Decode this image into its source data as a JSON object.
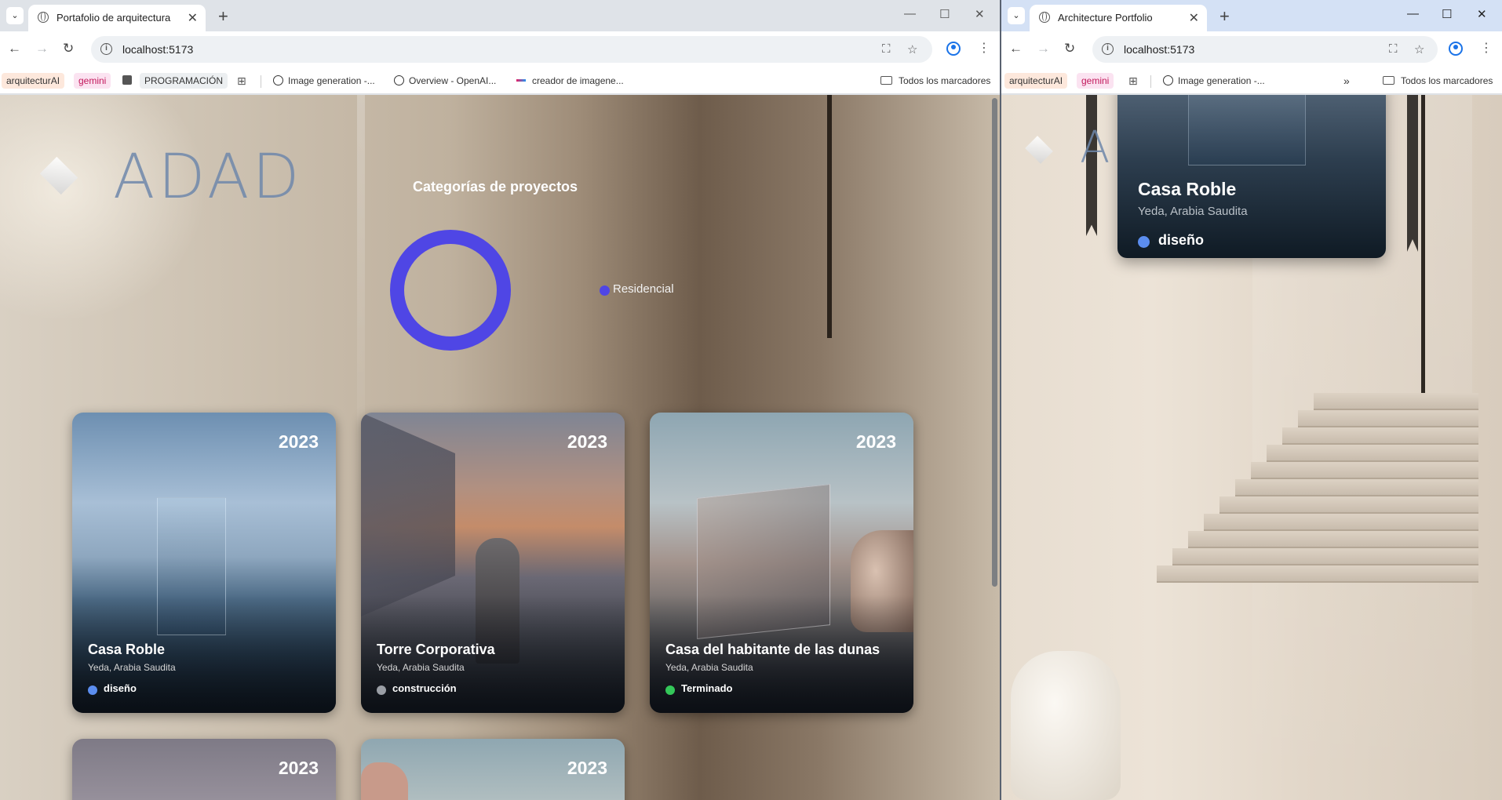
{
  "left_window": {
    "tab_title": "Portafolio de arquitectura",
    "url": "localhost:5173",
    "bookmarks": [
      {
        "label": "arquitecturAI",
        "bg": "#fde8dc"
      },
      {
        "label": "gemini",
        "bg": "#fbe3f1",
        "color": "#c2185b"
      },
      {
        "label": "PROGRAMACIÓN",
        "bg": "#eceff1"
      },
      {
        "label": "Image generation -..."
      },
      {
        "label": "Overview - OpenAI..."
      },
      {
        "label": "creador de imagene..."
      }
    ],
    "all_bookmarks": "Todos los marcadores",
    "page": {
      "logo": "ADAD",
      "chart_title": "Categorías de proyectos",
      "chart_data": {
        "type": "pie",
        "style": "donut",
        "categories": [
          "Residencial"
        ],
        "values": [
          1
        ],
        "colors": [
          "#4f46e5"
        ],
        "legend": "right"
      },
      "cards": [
        {
          "year": "2023",
          "name": "Casa Roble",
          "location": "Yeda, Arabia Saudita",
          "status": "diseño",
          "status_color": "#5b8def"
        },
        {
          "year": "2023",
          "name": "Torre Corporativa",
          "location": "Yeda, Arabia Saudita",
          "status": "construcción",
          "status_color": "#9a9ea5"
        },
        {
          "year": "2023",
          "name": "Casa del habitante de las dunas",
          "location": "Yeda, Arabia Saudita",
          "status": "Terminado",
          "status_color": "#34c759"
        },
        {
          "year": "2023"
        },
        {
          "year": "2023"
        }
      ]
    }
  },
  "right_window": {
    "tab_title": "Architecture Portfolio",
    "url": "localhost:5173",
    "bookmarks": [
      {
        "label": "arquitecturAI",
        "bg": "#fde8dc"
      },
      {
        "label": "gemini",
        "bg": "#fbe3f1",
        "color": "#c2185b"
      },
      {
        "label": "Image generation -..."
      }
    ],
    "all_bookmarks": "Todos los marcadores",
    "page": {
      "logo": "ADAD",
      "card": {
        "name": "Casa Roble",
        "location": "Yeda, Arabia Saudita",
        "status": "diseño",
        "status_color": "#5b8def"
      }
    }
  },
  "colors": {
    "accent": "#4f46e5",
    "chrome": "#dfe3e8",
    "link_blue": "#1a73e8"
  }
}
